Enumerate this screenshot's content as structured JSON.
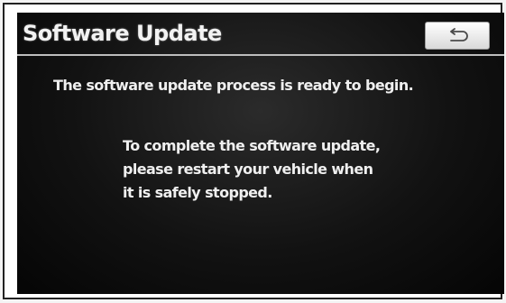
{
  "header": {
    "title": "Software Update",
    "back_icon": "return-arrow-icon"
  },
  "main": {
    "status": "The software update process is ready to begin.",
    "instructions": [
      "To complete the software update,",
      "please restart your vehicle when",
      "it is safely stopped."
    ]
  },
  "colors": {
    "screen_background": "#111111",
    "text": "#efefef",
    "button_background": "#f5f5f5"
  }
}
